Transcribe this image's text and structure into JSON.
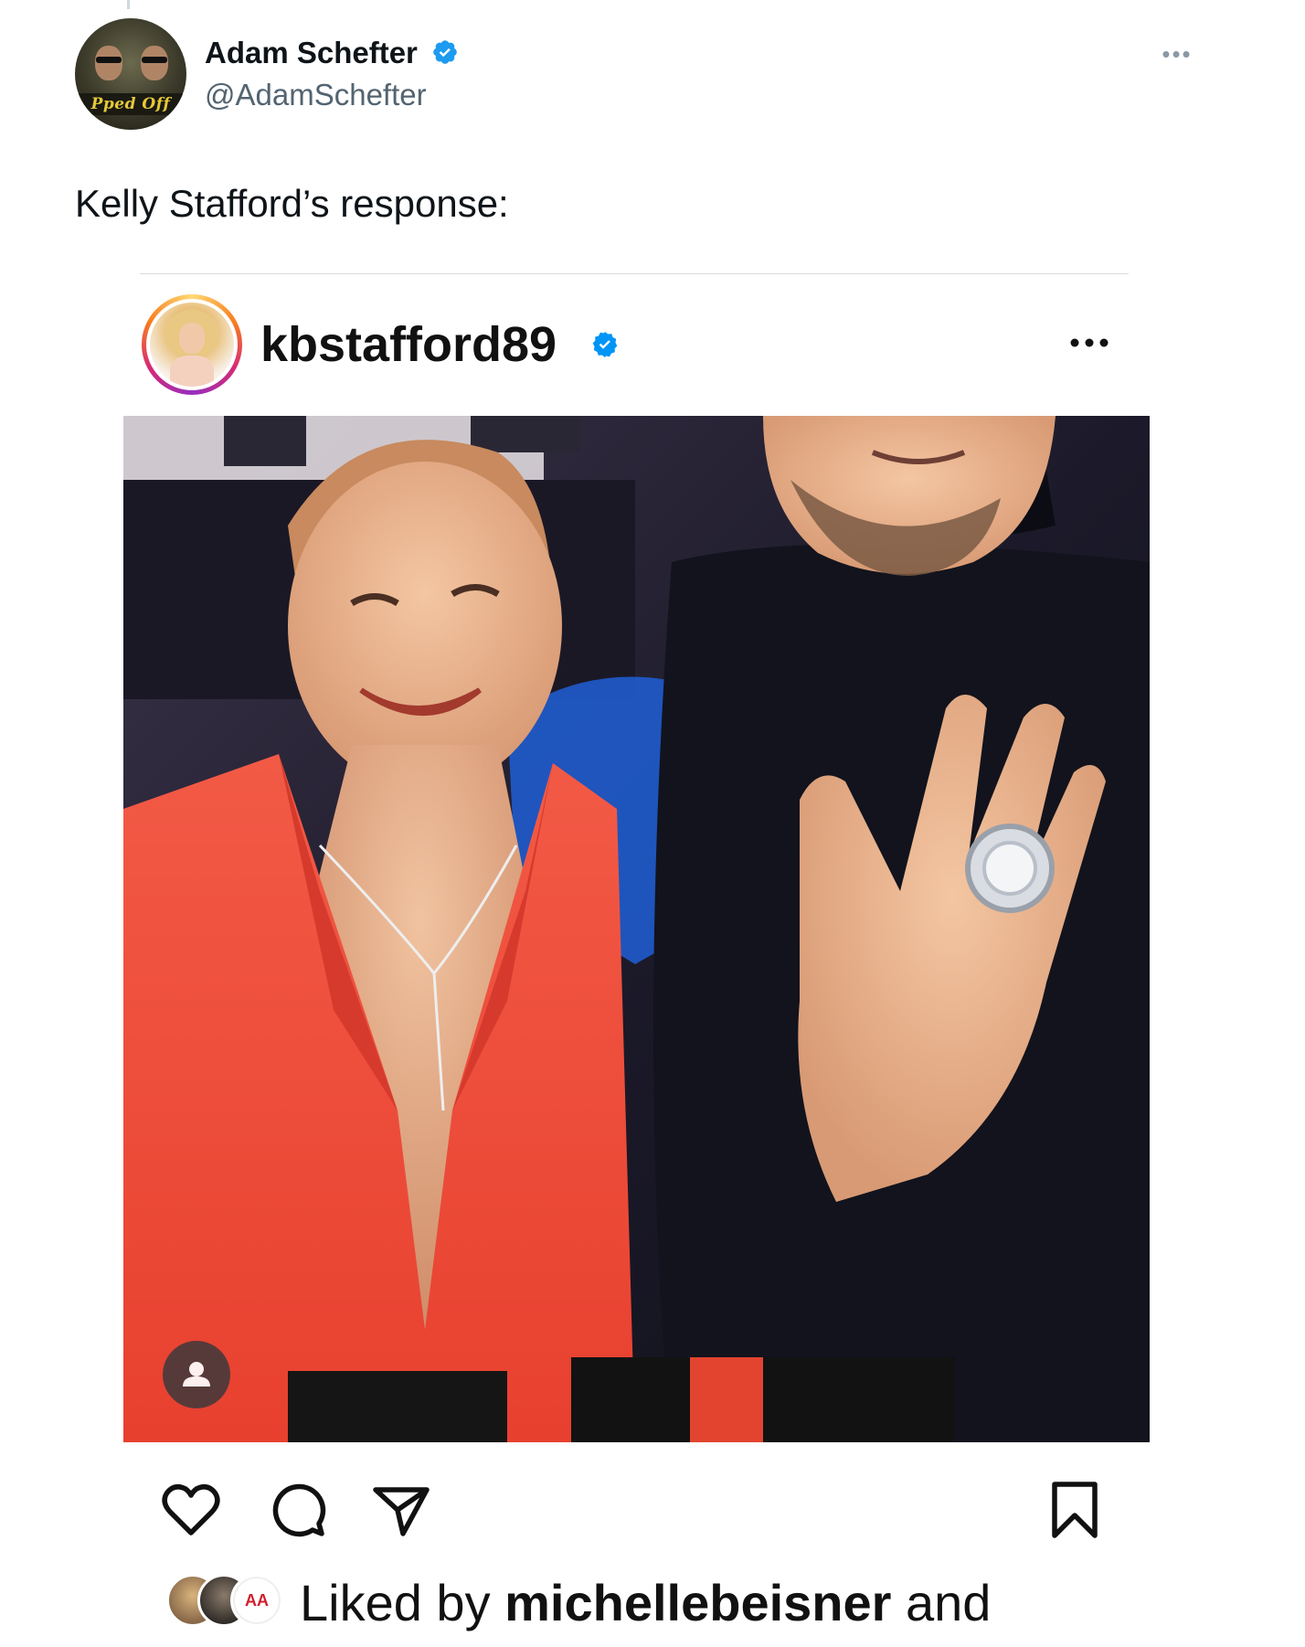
{
  "tweet": {
    "author_name": "Adam Schefter",
    "author_handle": "@AdamSchefter",
    "avatar_caption": "Pped Off",
    "text": "Kelly Stafford’s response:",
    "more_icon": "more-horizontal-icon"
  },
  "instagram_post": {
    "username": "kbstafford89",
    "verified": true,
    "liked_by_prefix": "Liked by",
    "liked_by_user": "michellebeisner",
    "liked_by_suffix": "and",
    "liker_avatar_3_text": "AA",
    "actions": [
      "heart-icon",
      "comment-icon",
      "share-icon",
      "bookmark-icon"
    ]
  },
  "colors": {
    "verified_blue": "#1d9bf0",
    "ig_verified_blue": "#0095f6",
    "handle_gray": "#536471",
    "blazer_coral": "#ee4a3d"
  }
}
